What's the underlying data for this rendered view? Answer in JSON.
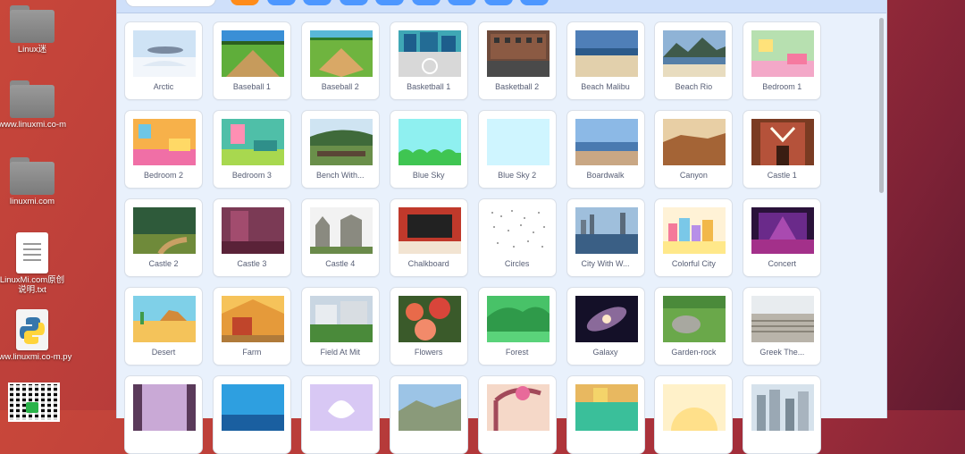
{
  "desktop": {
    "icons": [
      {
        "label": "Linux迷",
        "type": "folder"
      },
      {
        "label": "www.linuxmi.co-m",
        "type": "folder"
      },
      {
        "label": "linuxmi.com",
        "type": "folder"
      },
      {
        "label": "LinuxMi.com原创说明.txt",
        "type": "text-file"
      },
      {
        "label": "www.linuxmi.co-m.py",
        "type": "python-file"
      }
    ]
  },
  "library": {
    "category_tabs": [
      "",
      "",
      "",
      "",
      "",
      "",
      "",
      "",
      ""
    ],
    "active_tab_index": 0,
    "backdrops": [
      {
        "name": "Arctic"
      },
      {
        "name": "Baseball 1"
      },
      {
        "name": "Baseball 2"
      },
      {
        "name": "Basketball 1"
      },
      {
        "name": "Basketball 2"
      },
      {
        "name": "Beach Malibu"
      },
      {
        "name": "Beach Rio"
      },
      {
        "name": "Bedroom 1"
      },
      {
        "name": "Bedroom 2"
      },
      {
        "name": "Bedroom 3"
      },
      {
        "name": "Bench With..."
      },
      {
        "name": "Blue Sky"
      },
      {
        "name": "Blue Sky 2"
      },
      {
        "name": "Boardwalk"
      },
      {
        "name": "Canyon"
      },
      {
        "name": "Castle 1"
      },
      {
        "name": "Castle 2"
      },
      {
        "name": "Castle 3"
      },
      {
        "name": "Castle 4"
      },
      {
        "name": "Chalkboard"
      },
      {
        "name": "Circles"
      },
      {
        "name": "City With W..."
      },
      {
        "name": "Colorful City"
      },
      {
        "name": "Concert"
      },
      {
        "name": "Desert"
      },
      {
        "name": "Farm"
      },
      {
        "name": "Field At Mit"
      },
      {
        "name": "Flowers"
      },
      {
        "name": "Forest"
      },
      {
        "name": "Galaxy"
      },
      {
        "name": "Garden-rock"
      },
      {
        "name": "Greek The..."
      },
      {
        "name": ""
      },
      {
        "name": ""
      },
      {
        "name": ""
      },
      {
        "name": ""
      },
      {
        "name": ""
      },
      {
        "name": ""
      },
      {
        "name": ""
      },
      {
        "name": ""
      }
    ]
  },
  "colors": {
    "accent": "#4d97ff",
    "active_tab": "#ff8c1a",
    "label": "#575e75"
  }
}
